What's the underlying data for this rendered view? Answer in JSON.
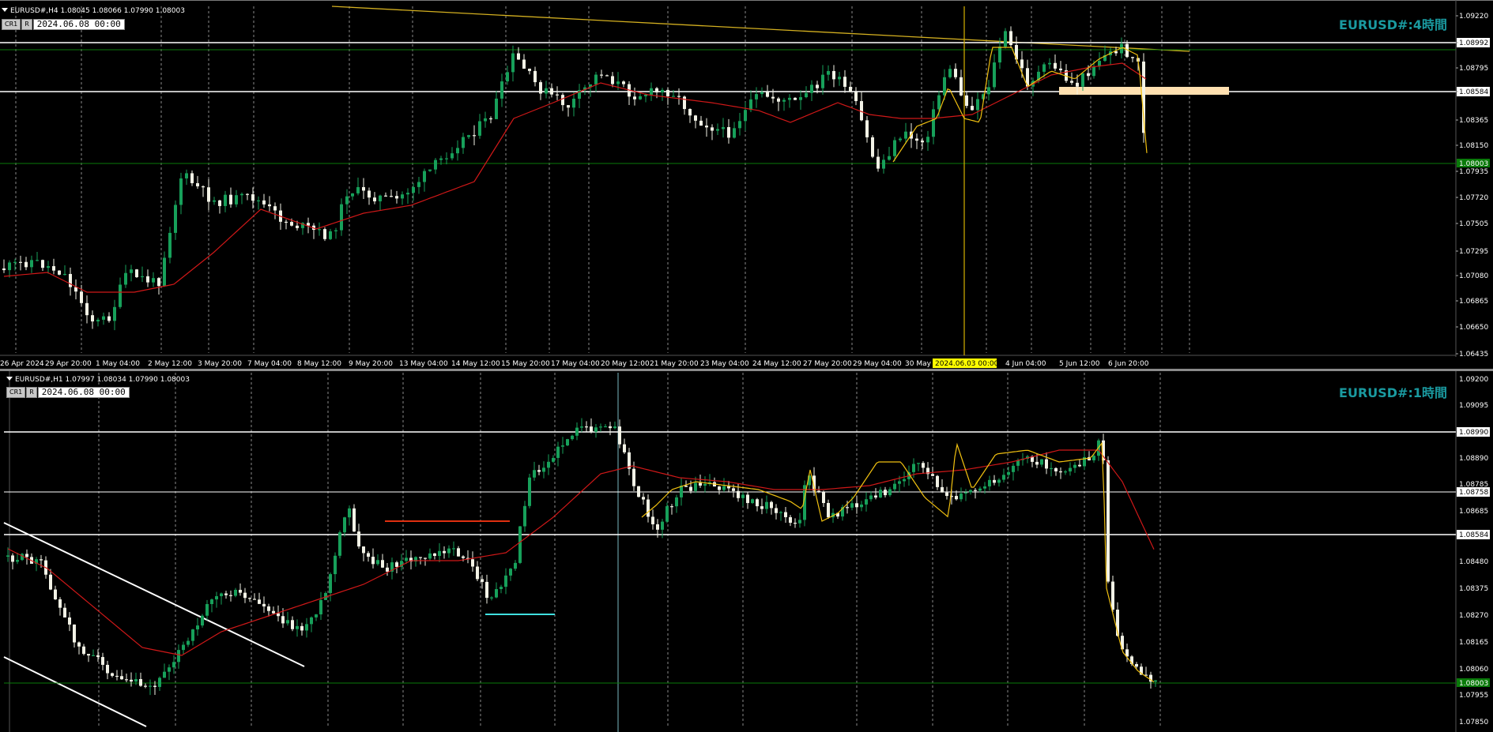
{
  "colors": {
    "background": "#000000",
    "grid": "#8a8a8a",
    "bull": "#17a05a",
    "bear": "#f2f2e6",
    "ma_red": "#d01818",
    "ma_yellow": "#f0c010",
    "hline": "#ffffff",
    "green_line": "#0a7a0a",
    "trend_gold": "#d4b020",
    "zone": "#ffe0b0",
    "title": "#1a9aa0",
    "price_tag_green": "#0a7a0a",
    "cross_yellow": "#d4b000",
    "cyan": "#40e0e0",
    "orange_red": "#e03010"
  },
  "top": {
    "header": "EURUSD#,H4  1.08045 1.08066 1.07990 1.08003",
    "buttons": [
      "CR1",
      "R"
    ],
    "date_field": "2024.06.08 00:00",
    "timeframe_title": "EURUSD#:4時間",
    "crosshair_date": "2024.06.03 00:00",
    "price_labels": [
      "1.09220",
      "1.08992",
      "1.08795",
      "1.08584",
      "1.08365",
      "1.08150",
      "1.07935",
      "1.07720",
      "1.07505",
      "1.07295",
      "1.07080",
      "1.06865",
      "1.06650",
      "1.06435"
    ],
    "current_price": "1.08003",
    "time_labels": [
      "26 Apr 2024",
      "29 Apr 20:00",
      "1 May 04:00",
      "2 May 12:00",
      "3 May 20:00",
      "7 May 04:00",
      "8 May 12:00",
      "9 May 20:00",
      "13 May 04:00",
      "14 May 12:00",
      "15 May 20:00",
      "17 May 04:00",
      "20 May 12:00",
      "21 May 20:00",
      "23 May 04:00",
      "24 May 12:00",
      "27 May 20:00",
      "29 May 04:00",
      "30 May",
      "4 Jun 04:00",
      "5 Jun 12:00",
      "6 Jun 20:00"
    ]
  },
  "bottom": {
    "header": "EURUSD#,H1  1.07997 1.08034 1.07990 1.08003",
    "buttons": [
      "CR1",
      "R"
    ],
    "date_field": "2024.06.08 00:00",
    "timeframe_title": "EURUSD#:1時間",
    "price_labels": [
      "1.09200",
      "1.09095",
      "1.08990",
      "1.08890",
      "1.08785",
      "1.08685",
      "1.08584",
      "1.08480",
      "1.08375",
      "1.08270",
      "1.08165",
      "1.08060",
      "1.07955",
      "1.07850"
    ],
    "current_price": "1.08003",
    "tagged_levels": [
      "1.08992",
      "1.08758",
      "1.08584"
    ]
  }
}
